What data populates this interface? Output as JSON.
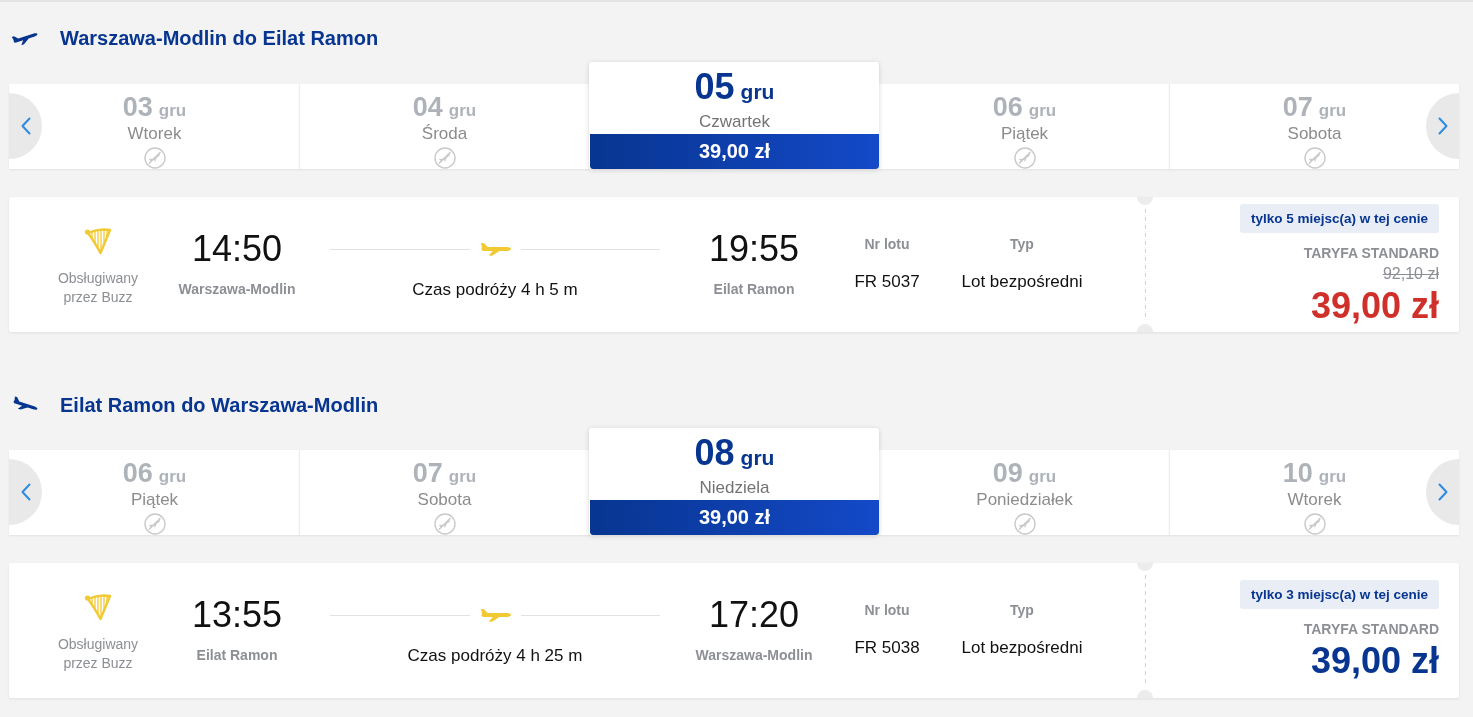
{
  "journeys": [
    {
      "kind": "outbound",
      "title": "Warszawa-Modlin do Eilat Ramon",
      "dates": [
        {
          "day": "03",
          "month": "gru",
          "weekday": "Wtorek",
          "selected": false,
          "available": false
        },
        {
          "day": "04",
          "month": "gru",
          "weekday": "Środa",
          "selected": false,
          "available": false
        },
        {
          "day": "05",
          "month": "gru",
          "weekday": "Czwartek",
          "selected": true,
          "available": true,
          "price": "39,00 zł"
        },
        {
          "day": "06",
          "month": "gru",
          "weekday": "Piątek",
          "selected": false,
          "available": false
        },
        {
          "day": "07",
          "month": "gru",
          "weekday": "Sobota",
          "selected": false,
          "available": false
        }
      ],
      "flight": {
        "operator": "Obsługiwany przez Buzz",
        "departure": {
          "time": "14:50",
          "station": "Warszawa-Modlin"
        },
        "duration": "Czas podróży 4 h 5 m",
        "arrival": {
          "time": "19:55",
          "station": "Eilat Ramon"
        },
        "flight_number_label": "Nr lotu",
        "flight_number": "FR 5037",
        "type_label": "Typ",
        "type": "Lot bezpośredni",
        "seats_badge": "tylko 5 miejsc(a) w tej cenie",
        "fare": "TARYFA STANDARD",
        "old_price": "92,10 zł",
        "price": "39,00 zł",
        "discounted": true
      }
    },
    {
      "kind": "return",
      "title": "Eilat Ramon do Warszawa-Modlin",
      "dates": [
        {
          "day": "06",
          "month": "gru",
          "weekday": "Piątek",
          "selected": false,
          "available": false
        },
        {
          "day": "07",
          "month": "gru",
          "weekday": "Sobota",
          "selected": false,
          "available": false
        },
        {
          "day": "08",
          "month": "gru",
          "weekday": "Niedziela",
          "selected": true,
          "available": true,
          "price": "39,00 zł"
        },
        {
          "day": "09",
          "month": "gru",
          "weekday": "Poniedziałek",
          "selected": false,
          "available": false
        },
        {
          "day": "10",
          "month": "gru",
          "weekday": "Wtorek",
          "selected": false,
          "available": false
        }
      ],
      "flight": {
        "operator": "Obsługiwany przez Buzz",
        "departure": {
          "time": "13:55",
          "station": "Eilat Ramon"
        },
        "duration": "Czas podróży 4 h 25 m",
        "arrival": {
          "time": "17:20",
          "station": "Warszawa-Modlin"
        },
        "flight_number_label": "Nr lotu",
        "flight_number": "FR 5038",
        "type_label": "Typ",
        "type": "Lot bezpośredni",
        "seats_badge": "tylko 3 miejsc(a) w tej cenie",
        "fare": "TARYFA STANDARD",
        "price": "39,00 zł",
        "discounted": false
      }
    }
  ]
}
